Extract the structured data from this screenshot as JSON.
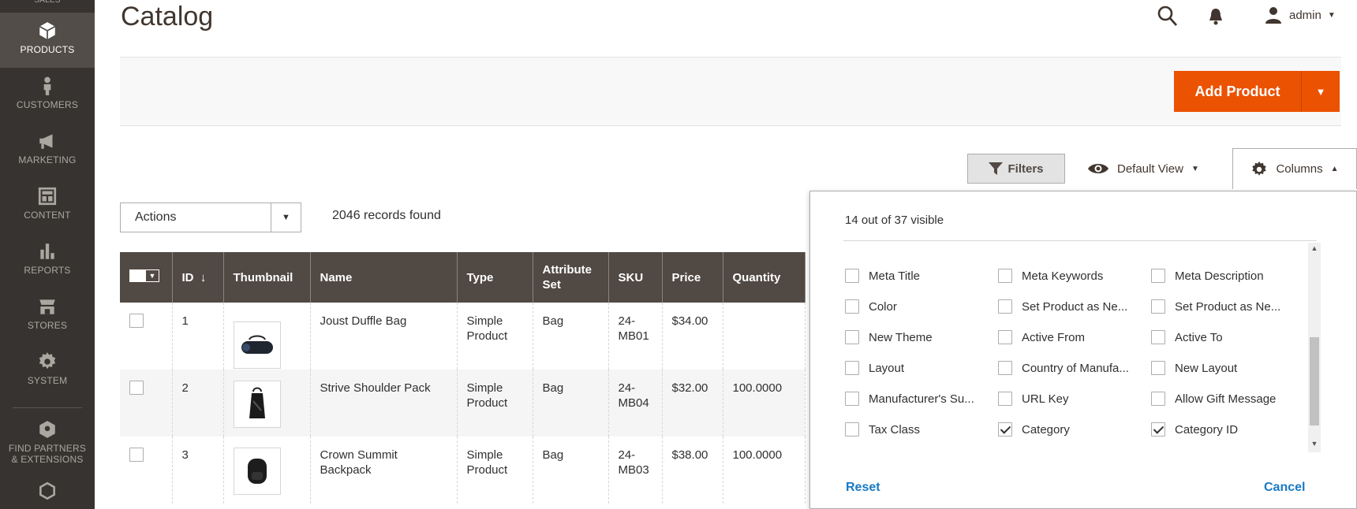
{
  "sidebar": {
    "items": [
      {
        "label": "SALES"
      },
      {
        "label": "PRODUCTS"
      },
      {
        "label": "CUSTOMERS"
      },
      {
        "label": "MARKETING"
      },
      {
        "label": "CONTENT"
      },
      {
        "label": "REPORTS"
      },
      {
        "label": "STORES"
      },
      {
        "label": "SYSTEM"
      },
      {
        "label": "FIND PARTNERS",
        "label2": "& EXTENSIONS"
      }
    ]
  },
  "header": {
    "title": "Catalog",
    "user": "admin"
  },
  "page_actions": {
    "add_product": "Add Product"
  },
  "toolbar": {
    "filters": "Filters",
    "view": "Default View",
    "columns": "Columns",
    "actions": "Actions",
    "records": "2046 records found"
  },
  "grid": {
    "headers": [
      "ID",
      "Thumbnail",
      "Name",
      "Type",
      "Attribute Set",
      "SKU",
      "Price",
      "Quantity"
    ],
    "sort_arrow": "↓",
    "rows": [
      {
        "id": "1",
        "name": "Joust Duffle Bag",
        "type": "Simple Product",
        "attribute_set": "Bag",
        "sku": "24-MB01",
        "price": "$34.00",
        "quantity": ""
      },
      {
        "id": "2",
        "name": "Strive Shoulder Pack",
        "type": "Simple Product",
        "attribute_set": "Bag",
        "sku": "24-MB04",
        "price": "$32.00",
        "quantity": "100.0000"
      },
      {
        "id": "3",
        "name": "Crown Summit Backpack",
        "type": "Simple Product",
        "attribute_set": "Bag",
        "sku": "24-MB03",
        "price": "$38.00",
        "quantity": "100.0000"
      }
    ]
  },
  "columns_panel": {
    "visible_count": "14 out of 37 visible",
    "options": [
      {
        "label": "Meta Title",
        "checked": false
      },
      {
        "label": "Meta Keywords",
        "checked": false
      },
      {
        "label": "Meta Description",
        "checked": false
      },
      {
        "label": "Color",
        "checked": false
      },
      {
        "label": "Set Product as Ne...",
        "checked": false
      },
      {
        "label": "Set Product as Ne...",
        "checked": false
      },
      {
        "label": "New Theme",
        "checked": false
      },
      {
        "label": "Active From",
        "checked": false
      },
      {
        "label": "Active To",
        "checked": false
      },
      {
        "label": "Layout",
        "checked": false
      },
      {
        "label": "Country of Manufa...",
        "checked": false
      },
      {
        "label": "New Layout",
        "checked": false
      },
      {
        "label": "Manufacturer's Su...",
        "checked": false
      },
      {
        "label": "URL Key",
        "checked": false
      },
      {
        "label": "Allow Gift Message",
        "checked": false
      },
      {
        "label": "Tax Class",
        "checked": false
      },
      {
        "label": "Category",
        "checked": true
      },
      {
        "label": "Category ID",
        "checked": true
      }
    ],
    "reset": "Reset",
    "cancel": "Cancel"
  },
  "colors": {
    "sidebar_bg": "#373330",
    "accent_orange": "#eb5202",
    "grid_header_bg": "#514943",
    "link_blue": "#1979c3"
  },
  "icons": {
    "search": "search-icon",
    "notifications": "bell-icon",
    "user": "user-icon",
    "filter": "funnel-icon",
    "view": "eye-icon",
    "columns": "gear-icon"
  }
}
